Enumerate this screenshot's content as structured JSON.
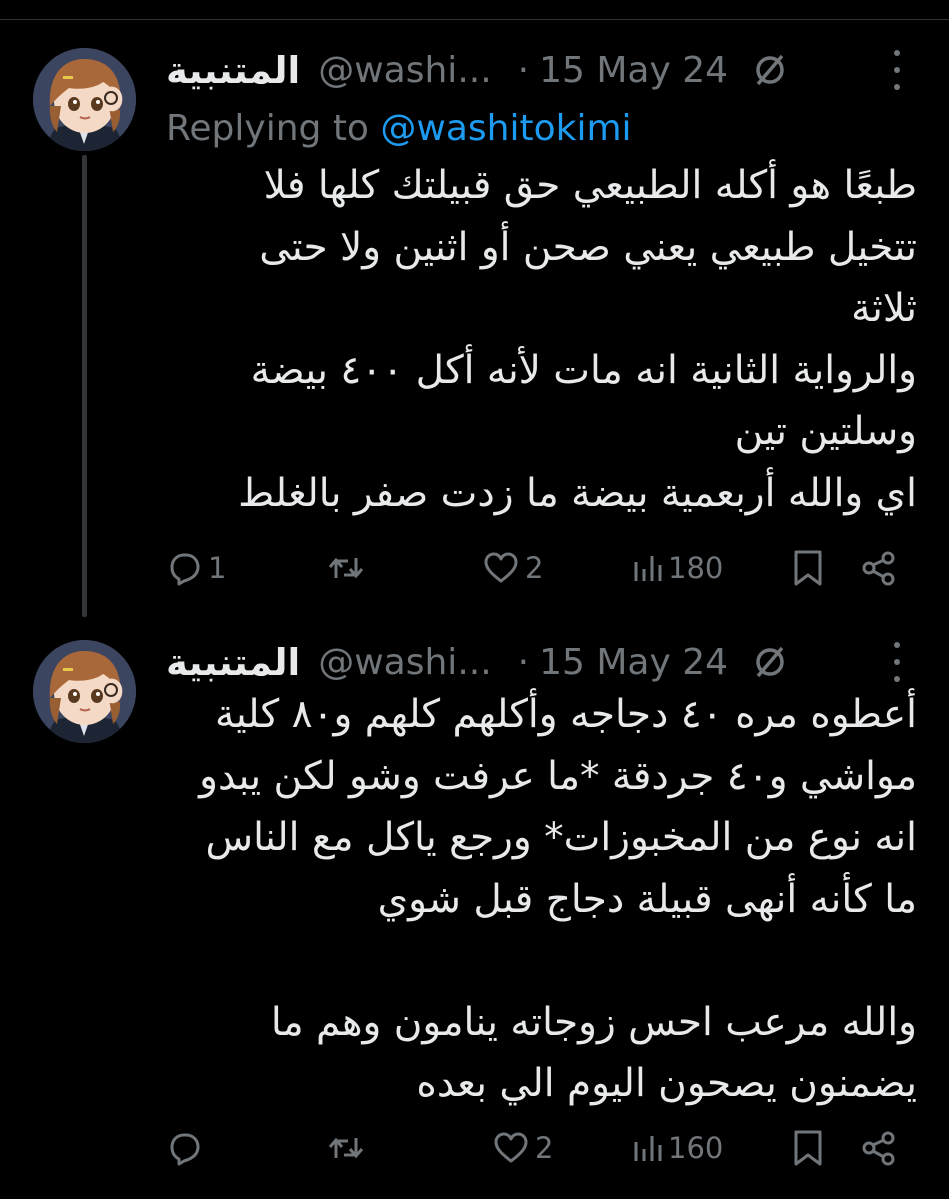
{
  "tweets": [
    {
      "display_name": "المتنبية",
      "handle": "@washi...",
      "separator": "·",
      "date": "15 May 24",
      "replying_prefix": "Replying to",
      "replying_handle": "@washitokimi",
      "text": "طبعًا هو أكله الطبيعي حق قبيلتك كلها فلا\nتتخيل طبيعي يعني صحن أو اثنين ولا حتى\nثلاثة\nوالرواية الثانية انه مات لأنه أكل ٤٠٠ بيضة\nوسلتين تين\nاي والله أربعمية بيضة ما زدت صفر بالغلط",
      "actions": {
        "replies": "1",
        "retweets": "",
        "likes": "2",
        "views": "180"
      }
    },
    {
      "display_name": "المتنبية",
      "handle": "@washi...",
      "separator": "·",
      "date": "15 May 24",
      "text": "أعطوه مره ٤٠ دجاجه وأكلهم كلهم و٨٠ كلية\nمواشي و٤٠ جردقة *ما عرفت وشو لكن يبدو\nانه نوع من المخبوزات* ورجع ياكل مع الناس\nما كأنه أنهى قبيلة دجاج قبل شوي\n\nوالله مرعب احس زوجاته ينامون وهم ما\nيضمنون يصحون اليوم الي بعده",
      "actions": {
        "replies": "",
        "retweets": "",
        "likes": "2",
        "views": "160"
      }
    }
  ],
  "icons": {
    "avatar": "anime-girl-avatar",
    "ban": "circle-slash-icon",
    "more": "more-vertical-icon",
    "reply": "reply-icon",
    "retweet": "retweet-icon",
    "like": "heart-icon",
    "views": "views-icon",
    "bookmark": "bookmark-icon",
    "share": "share-icon"
  },
  "colors": {
    "background": "#000000",
    "text": "#e7e9ea",
    "muted": "#71767b",
    "link": "#1d9bf0"
  }
}
